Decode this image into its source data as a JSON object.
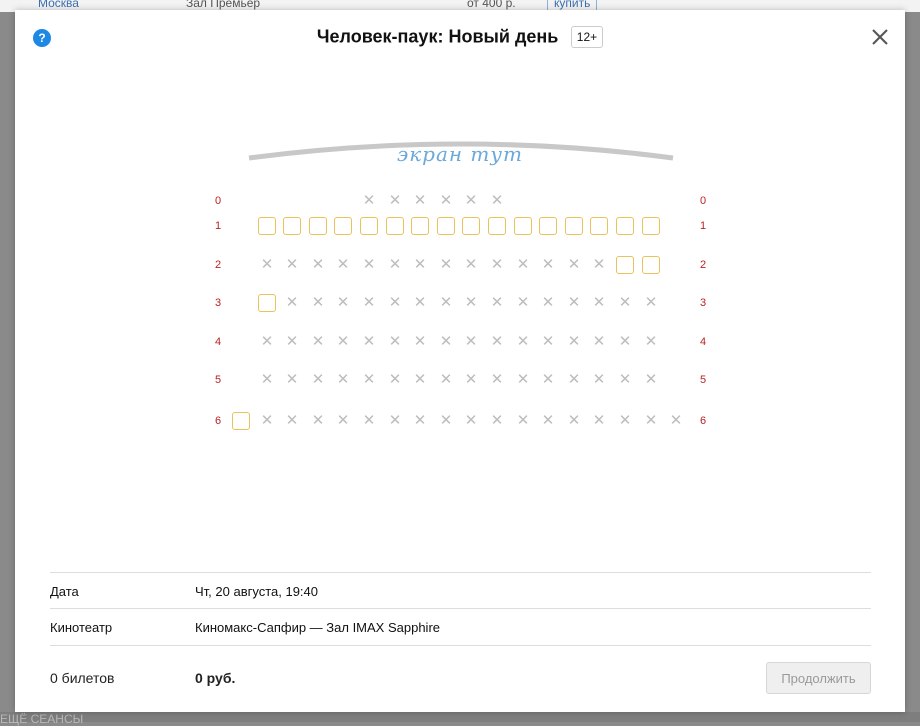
{
  "background": {
    "city": "Москва",
    "hall": "Зал Премьер",
    "price": "от 400 р.",
    "buy": "купить",
    "bottom_text": "ЕЩЁ СЕАНСЫ"
  },
  "modal": {
    "help_symbol": "?",
    "title": "Человек-паук: Новый день",
    "age_rating": "12+",
    "close_icon": "close-icon"
  },
  "screen_label": "экран тут",
  "seat_colors": {
    "free": "#e8c25a",
    "taken": "#bdbdbd",
    "row_number": "#bb2222"
  },
  "seat_map": {
    "rows": [
      {
        "label": "0",
        "seats": [
          "",
          "",
          "",
          "",
          "",
          "x",
          "x",
          "x",
          "x",
          "x",
          "x",
          "",
          "",
          "",
          "",
          "",
          "",
          ""
        ]
      },
      {
        "label": "1",
        "seats": [
          "",
          "o",
          "o",
          "o",
          "o",
          "o",
          "o",
          "o",
          "o",
          "o",
          "o",
          "o",
          "o",
          "o",
          "o",
          "o",
          "o",
          ""
        ]
      },
      {
        "label": "2",
        "seats": [
          "",
          "x",
          "x",
          "x",
          "x",
          "x",
          "x",
          "x",
          "x",
          "x",
          "x",
          "x",
          "x",
          "x",
          "x",
          "o",
          "o",
          ""
        ]
      },
      {
        "label": "3",
        "seats": [
          "",
          "o",
          "x",
          "x",
          "x",
          "x",
          "x",
          "x",
          "x",
          "x",
          "x",
          "x",
          "x",
          "x",
          "x",
          "x",
          "x",
          ""
        ]
      },
      {
        "label": "4",
        "seats": [
          "",
          "x",
          "x",
          "x",
          "x",
          "x",
          "x",
          "x",
          "x",
          "x",
          "x",
          "x",
          "x",
          "x",
          "x",
          "x",
          "x",
          ""
        ]
      },
      {
        "label": "5",
        "seats": [
          "",
          "x",
          "x",
          "x",
          "x",
          "x",
          "x",
          "x",
          "x",
          "x",
          "x",
          "x",
          "x",
          "x",
          "x",
          "x",
          "x",
          ""
        ]
      },
      {
        "label": "6",
        "seats": [
          "o",
          "x",
          "x",
          "x",
          "x",
          "x",
          "x",
          "x",
          "x",
          "x",
          "x",
          "x",
          "x",
          "x",
          "x",
          "x",
          "x",
          "x"
        ]
      }
    ]
  },
  "info": {
    "date_label": "Дата",
    "date_value": "Чт, 20 августа, 19:40",
    "cinema_label": "Кинотеатр",
    "cinema_value": "Киномакс-Сапфир — Зал IMAX Sapphire"
  },
  "footer": {
    "tickets": "0 билетов",
    "total": "0 руб.",
    "continue_label": "Продолжить"
  }
}
